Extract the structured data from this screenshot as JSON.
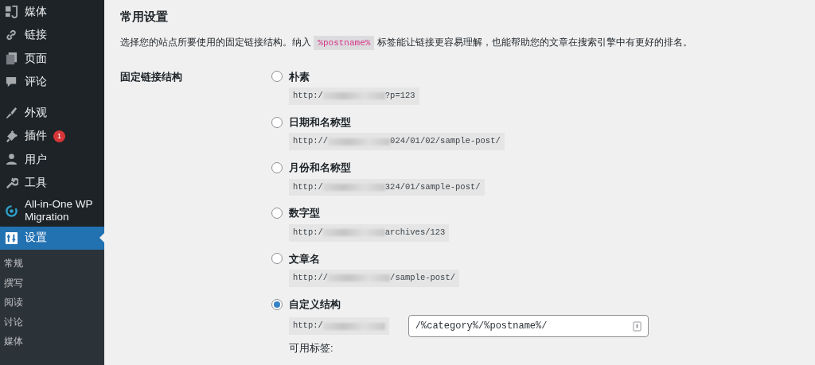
{
  "sidebar": {
    "items": [
      {
        "label": "媒体",
        "selected": false
      },
      {
        "label": "链接",
        "selected": false
      },
      {
        "label": "页面",
        "selected": false
      },
      {
        "label": "评论",
        "selected": false
      },
      {
        "label": "外观",
        "selected": false
      },
      {
        "label": "插件",
        "selected": false,
        "badge": "1"
      },
      {
        "label": "用户",
        "selected": false
      },
      {
        "label": "工具",
        "selected": false
      },
      {
        "label": "All-in-One WP Migration",
        "selected": false
      },
      {
        "label": "设置",
        "selected": true
      }
    ],
    "submenu": [
      "常规",
      "撰写",
      "阅读",
      "讨论",
      "媒体"
    ]
  },
  "page": {
    "title": "常用设置",
    "description": "选择您的站点所要使用的固定链接结构。纳入 ",
    "description_code": "%postname%",
    "description_tail": " 标签能让链接更容易理解，也能帮助您的文章在搜索引擎中有更好的排名。",
    "setting_label": "固定链接结构",
    "options": [
      {
        "label": "朴素",
        "selected": false,
        "url_prefix": "http:/",
        "url_suffix": "?p=123"
      },
      {
        "label": "日期和名称型",
        "selected": false,
        "url_prefix": "http://",
        "url_suffix": "024/01/02/sample-post/"
      },
      {
        "label": "月份和名称型",
        "selected": false,
        "url_prefix": "http:/",
        "url_suffix": "324/01/sample-post/"
      },
      {
        "label": "数字型",
        "selected": false,
        "url_prefix": "http:/",
        "url_suffix": "archives/123"
      },
      {
        "label": "文章名",
        "selected": false,
        "url_prefix": "http://",
        "url_suffix": "/sample-post/"
      },
      {
        "label": "自定义结构",
        "selected": true,
        "url_prefix": "http:/",
        "custom_value": "/%category%/%postname%/"
      }
    ],
    "available_tags_label": "可用标签:"
  }
}
